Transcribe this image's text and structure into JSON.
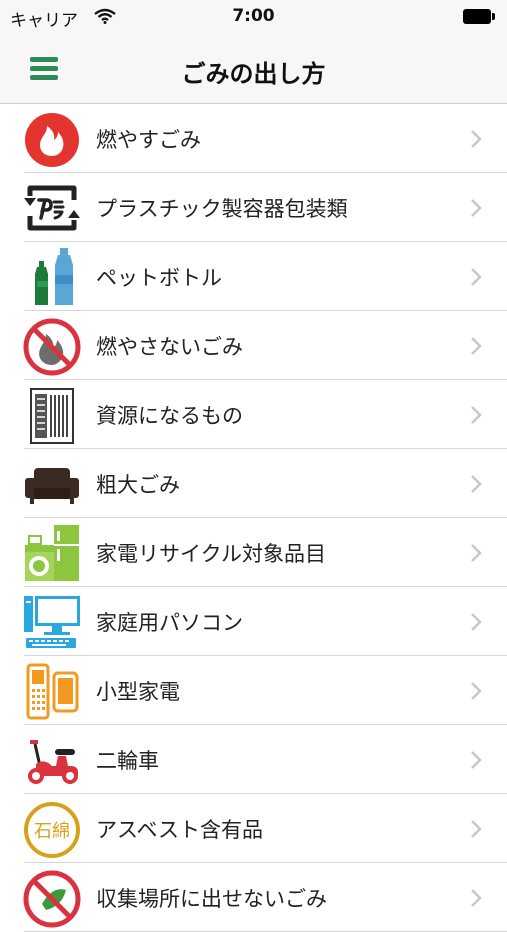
{
  "status": {
    "carrier": "キャリア",
    "time": "7:00"
  },
  "header": {
    "title": "ごみの出し方"
  },
  "menu": {
    "icon": "hamburger-menu-icon"
  },
  "items": [
    {
      "id": "burnable",
      "label": "燃やすごみ",
      "icon": "flame-icon"
    },
    {
      "id": "plastic",
      "label": "プラスチック製容器包装類",
      "icon": "plastic-recycle-icon"
    },
    {
      "id": "pet",
      "label": "ペットボトル",
      "icon": "pet-bottle-icon"
    },
    {
      "id": "nonburnable",
      "label": "燃やさないごみ",
      "icon": "no-burn-icon"
    },
    {
      "id": "resources",
      "label": "資源になるもの",
      "icon": "newspaper-icon"
    },
    {
      "id": "oversized",
      "label": "粗大ごみ",
      "icon": "sofa-icon"
    },
    {
      "id": "appliances",
      "label": "家電リサイクル対象品目",
      "icon": "appliances-icon"
    },
    {
      "id": "pc",
      "label": "家庭用パソコン",
      "icon": "computer-icon"
    },
    {
      "id": "small-appliances",
      "label": "小型家電",
      "icon": "phone-icon"
    },
    {
      "id": "motorbike",
      "label": "二輪車",
      "icon": "scooter-icon"
    },
    {
      "id": "asbestos",
      "label": "アスベスト含有品",
      "icon": "asbestos-badge-icon",
      "badge_text": "石綿"
    },
    {
      "id": "not-collected",
      "label": "収集場所に出せないごみ",
      "icon": "no-collect-icon"
    }
  ],
  "colors": {
    "accent": "#2e8b57",
    "flame": "#e3342f",
    "pet_green": "#1f7a3a",
    "pet_blue": "#5aa6d6",
    "appliance_green": "#8cc63f",
    "pc_blue": "#29a8e0",
    "phone_orange": "#f29a1f",
    "scooter_red": "#d9333f",
    "asbestos_gold": "#d7a21a"
  }
}
